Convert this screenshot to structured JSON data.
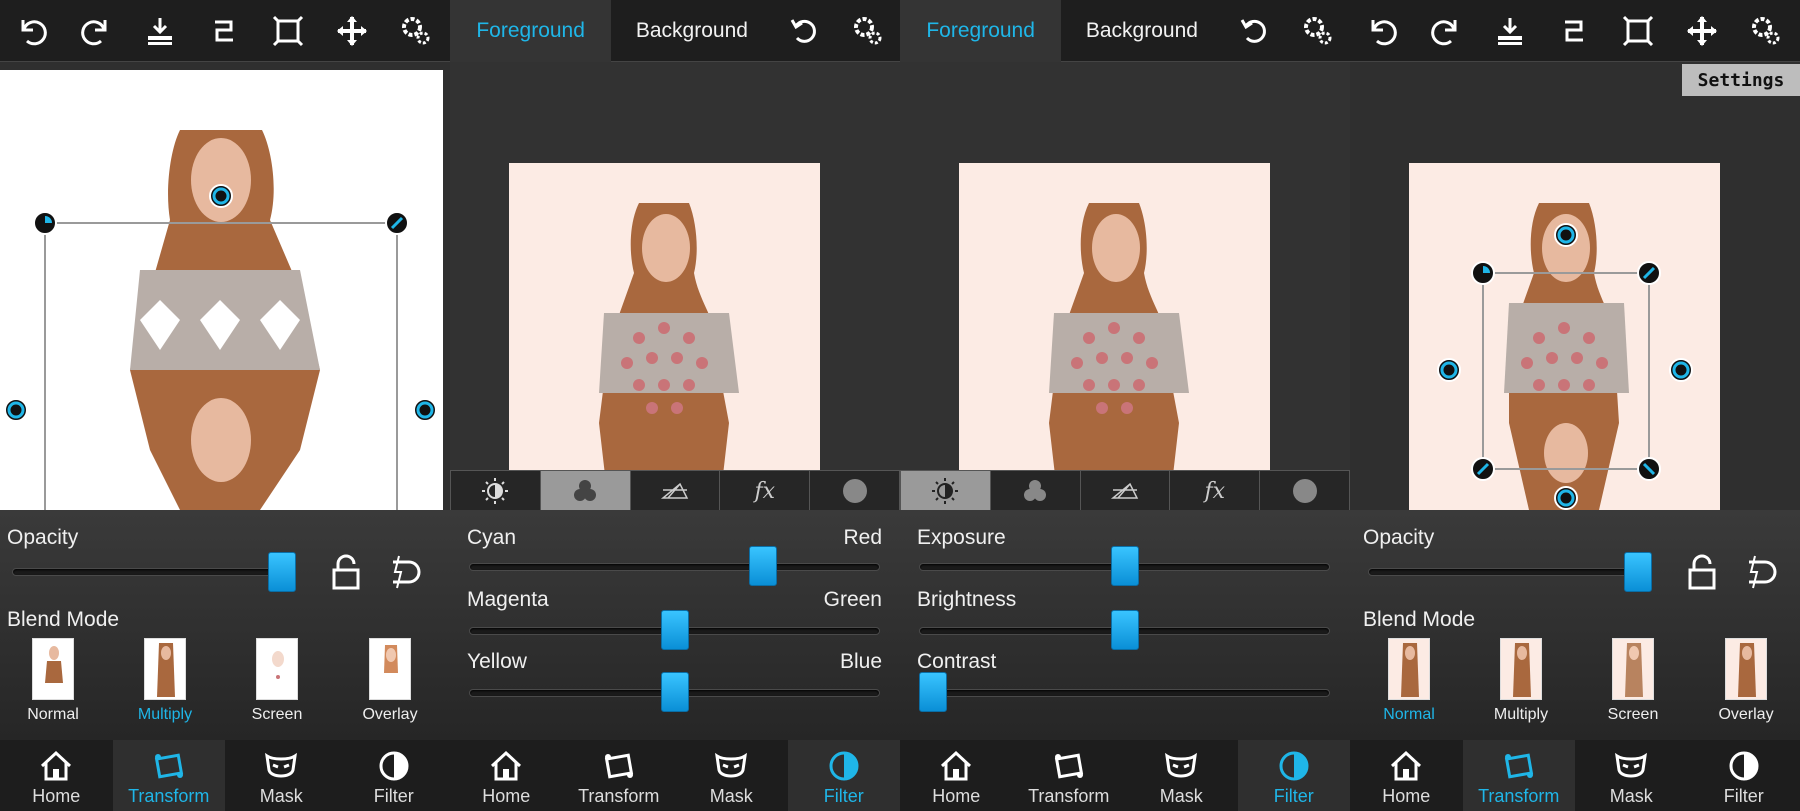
{
  "panels": {
    "transform_left": {
      "opacity_label": "Opacity",
      "opacity_value": 0.95,
      "blend_label": "Blend Mode",
      "blend_modes": [
        "Normal",
        "Multiply",
        "Screen",
        "Overlay"
      ],
      "active_blend": "Multiply"
    },
    "filter_color": {
      "tabs": [
        "fx"
      ],
      "left_labels": [
        "Cyan",
        "Magenta",
        "Yellow"
      ],
      "right_labels": [
        "Red",
        "Green",
        "Blue"
      ],
      "values": [
        0.73,
        0.5,
        0.5
      ]
    },
    "filter_light": {
      "tabs": [
        "fx"
      ],
      "labels": [
        "Exposure",
        "Brightness",
        "Contrast"
      ],
      "values": [
        0.5,
        0.5,
        0.0
      ]
    },
    "transform_right": {
      "opacity_label": "Opacity",
      "opacity_value": 0.95,
      "blend_label": "Blend Mode",
      "blend_modes": [
        "Normal",
        "Multiply",
        "Screen",
        "Overlay"
      ],
      "active_blend": "Normal",
      "settings_label": "Settings"
    }
  },
  "toolbar": {
    "foreground": "Foreground",
    "background": "Background"
  },
  "nav": [
    "Home",
    "Transform",
    "Mask",
    "Filter"
  ],
  "accent": "#1fb6e8"
}
